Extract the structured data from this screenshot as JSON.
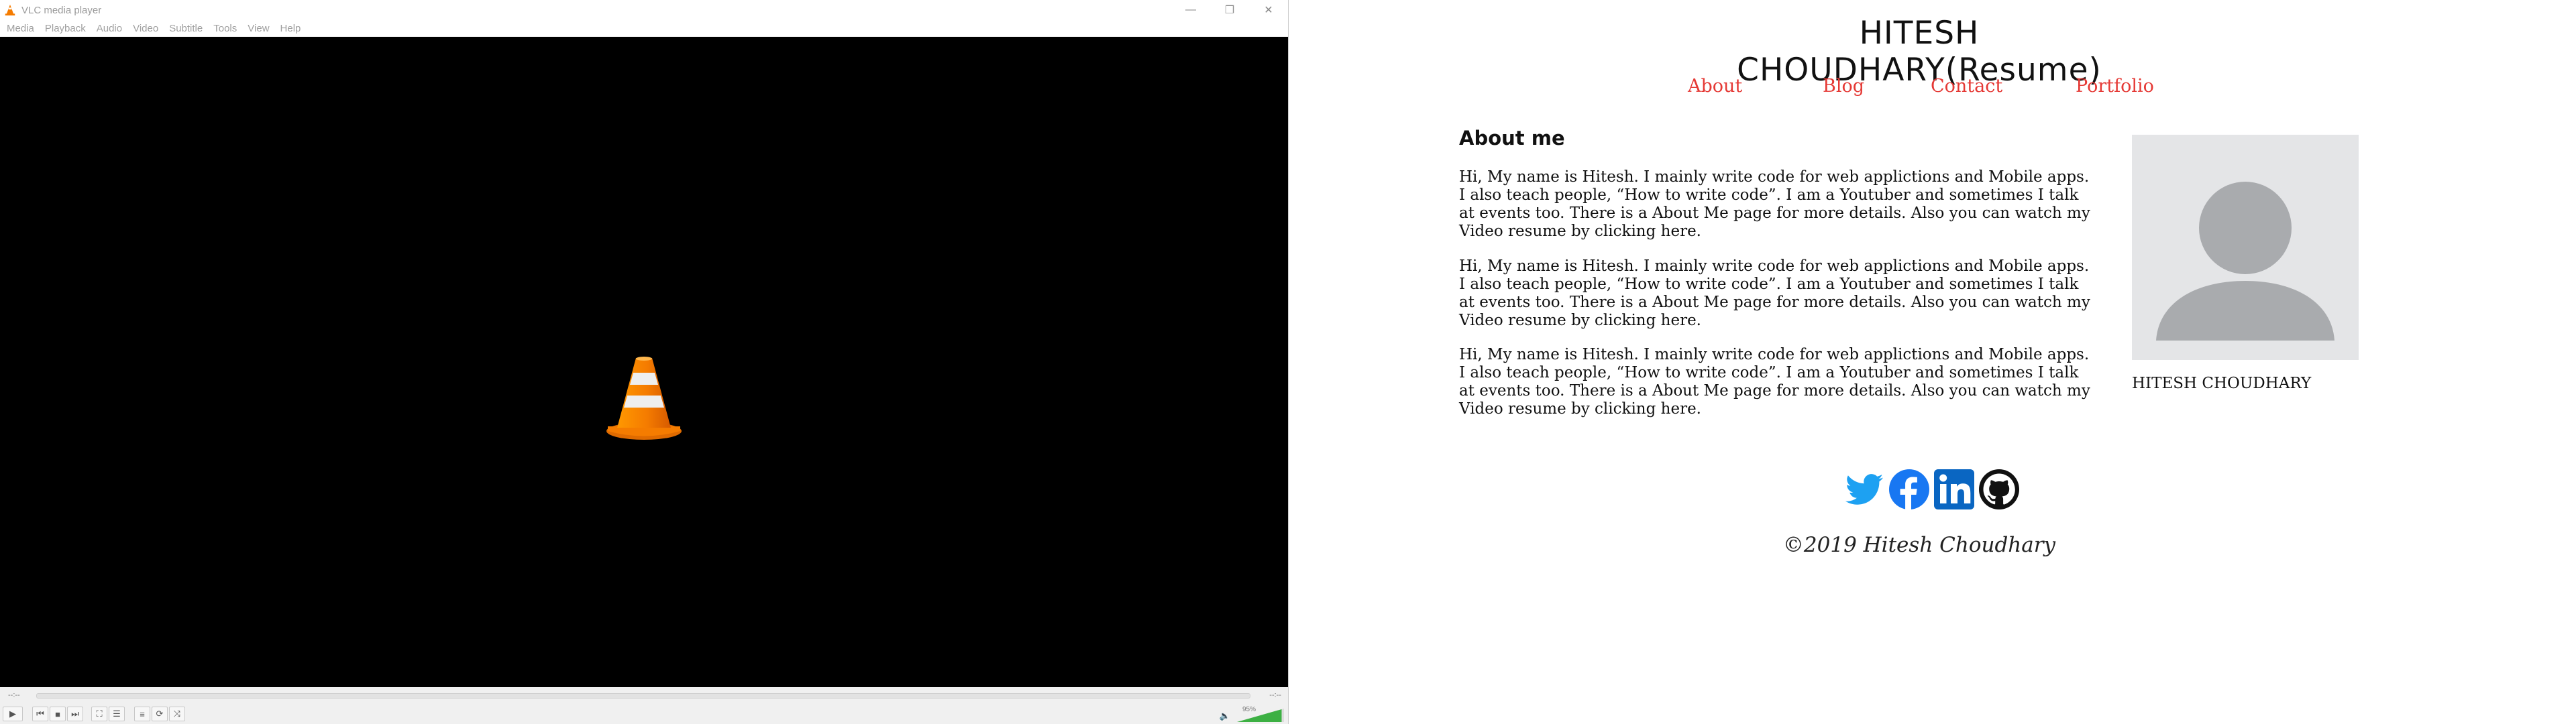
{
  "vlc": {
    "title": "VLC media player",
    "window_controls": [
      "minimize",
      "restore",
      "close"
    ],
    "menu": [
      "Media",
      "Playback",
      "Audio",
      "Video",
      "Subtitle",
      "Tools",
      "View",
      "Help"
    ],
    "elapsed": "--:--",
    "remaining": "--:--",
    "volume_label": "95%",
    "volume_level": 0.95,
    "icons": {
      "app": "vlc-cone-icon",
      "play": "play-icon",
      "prev": "previous-icon",
      "stop": "stop-icon",
      "next": "next-icon",
      "fullscreen": "fullscreen-icon",
      "extended": "extended-settings-icon",
      "playlist": "playlist-icon",
      "loop": "loop-icon",
      "shuffle": "shuffle-icon",
      "volume": "speaker-icon"
    },
    "colors": {
      "cone_orange": "#f57c00",
      "volume_green": "#3cb043"
    }
  },
  "resume": {
    "title": "HITESH CHOUDHARY(Resume)",
    "nav": [
      "About",
      "Blog",
      "Contact",
      "Portfolio"
    ],
    "about_heading": "About me",
    "paragraphs": [
      "Hi, My name is Hitesh. I mainly write code for web applictions and Mobile apps. I also teach people, “How to write code”. I am a Youtuber and sometimes I talk at events too. There is a About Me page for more details. Also you can watch my Video resume by clicking here.",
      "Hi, My name is Hitesh. I mainly write code for web applictions and Mobile apps. I also teach people, “How to write code”. I am a Youtuber and sometimes I talk at events too. There is a About Me page for more details. Also you can watch my Video resume by clicking here.",
      "Hi, My name is Hitesh. I mainly write code for web applictions and Mobile apps. I also teach people, “How to write code”. I am a Youtuber and sometimes I talk at events too. There is a About Me page for more details. Also you can watch my Video resume by clicking here."
    ],
    "avatar_name": "HITESH CHOUDHARY",
    "socials": [
      "twitter-icon",
      "facebook-icon",
      "linkedin-icon",
      "github-icon"
    ],
    "footer": "©2019 Hitesh Choudhary",
    "colors": {
      "nav_link": "#e53935",
      "twitter": "#1da1f2",
      "facebook": "#1877f2",
      "linkedin": "#0a66c2",
      "github": "#111111",
      "avatar_bg": "#e4e5e7",
      "avatar_fg": "#a9abae"
    }
  }
}
